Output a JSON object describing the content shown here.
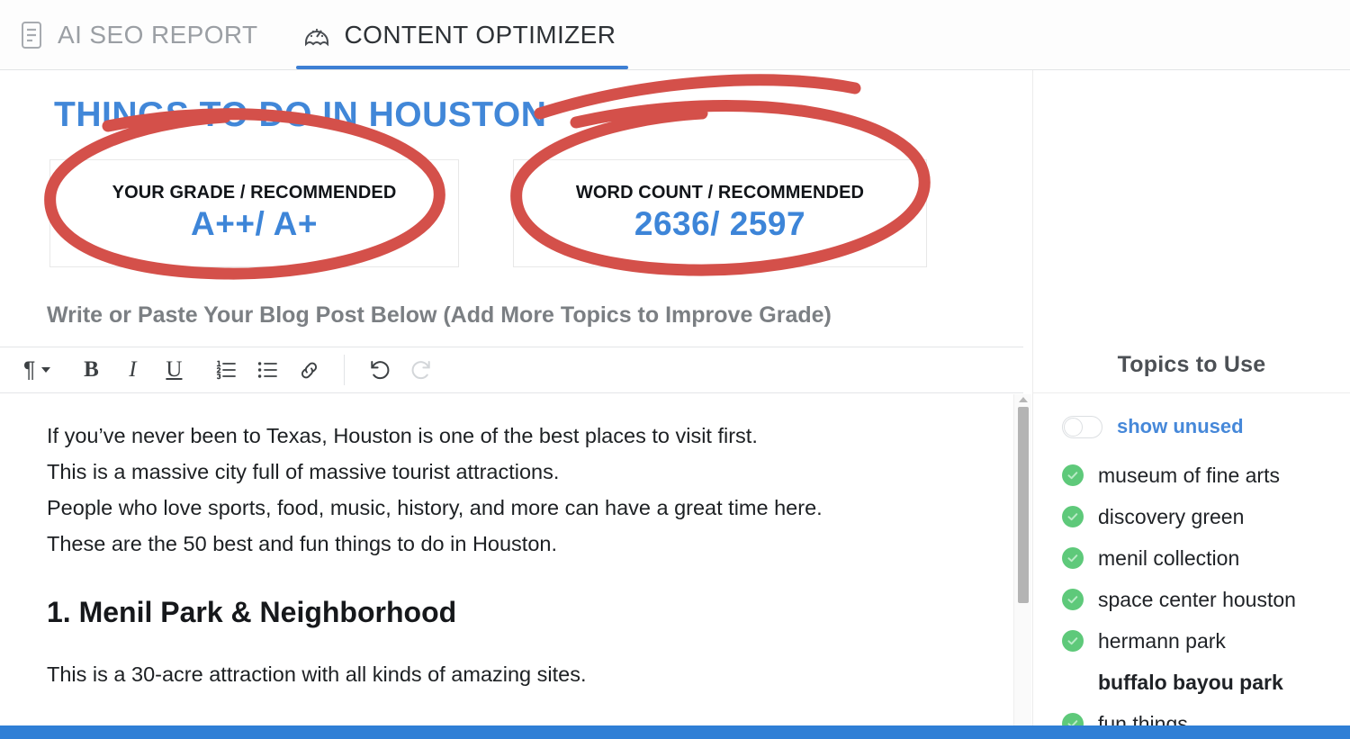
{
  "tabs": [
    {
      "label": "AI SEO REPORT",
      "icon": "report-document-icon",
      "active": false
    },
    {
      "label": "CONTENT OPTIMIZER",
      "icon": "gauge-icon",
      "active": true
    }
  ],
  "post": {
    "title": "THINGS TO DO IN HOUSTON"
  },
  "cards": [
    {
      "caption": "YOUR GRADE / RECOMMENDED",
      "value": "A++/ A+"
    },
    {
      "caption": "WORD COUNT / RECOMMENDED",
      "value": "2636/ 2597"
    }
  ],
  "subhead": "Write or Paste Your Blog Post Below (Add More Topics to Improve Grade)",
  "toolbar": {
    "paragraph_glyph": "¶",
    "bold_label": "B",
    "italic_label": "I",
    "underline_label": "U",
    "buttons": [
      {
        "name": "paragraph-style-dropdown",
        "title": "Paragraph style",
        "disabled": false
      },
      {
        "name": "bold-button",
        "title": "Bold",
        "disabled": false
      },
      {
        "name": "italic-button",
        "title": "Italic",
        "disabled": false
      },
      {
        "name": "underline-button",
        "title": "Underline",
        "disabled": false
      },
      {
        "name": "ordered-list-button",
        "title": "Numbered list",
        "disabled": false
      },
      {
        "name": "unordered-list-button",
        "title": "Bulleted list",
        "disabled": false
      },
      {
        "name": "link-button",
        "title": "Insert link",
        "disabled": false
      },
      {
        "name": "undo-button",
        "title": "Undo",
        "disabled": false
      },
      {
        "name": "redo-button",
        "title": "Redo",
        "disabled": true
      }
    ]
  },
  "document": {
    "intro": [
      "If you’ve never been to Texas, Houston is one of the best places to visit first.",
      "This is a massive city full of massive tourist attractions.",
      "People who love sports, food, music, history, and more can have a great time here.",
      "These are the 50 best and fun things to do in Houston."
    ],
    "heading": "1. Menil Park & Neighborhood",
    "paragraph": "This is a 30-acre attraction with all kinds of amazing sites."
  },
  "panel": {
    "title": "Topics to Use",
    "toggle": {
      "label": "show unused",
      "on": false
    },
    "topics": [
      {
        "label": "museum of fine arts",
        "used": true
      },
      {
        "label": "discovery green",
        "used": true
      },
      {
        "label": "menil collection",
        "used": true
      },
      {
        "label": "space center houston",
        "used": true
      },
      {
        "label": "hermann park",
        "used": true
      },
      {
        "label": "buffalo bayou park",
        "used": false
      },
      {
        "label": "fun things",
        "used": true
      }
    ]
  },
  "colors": {
    "accent_blue": "#3d85d8",
    "tab_underline": "#3d7fd4",
    "title_blue": "#4187d8",
    "annotation_red": "#d4504a",
    "check_green": "#5ec97a",
    "bottom_bar": "#2f7fd6",
    "muted_text": "#7b7f83"
  }
}
